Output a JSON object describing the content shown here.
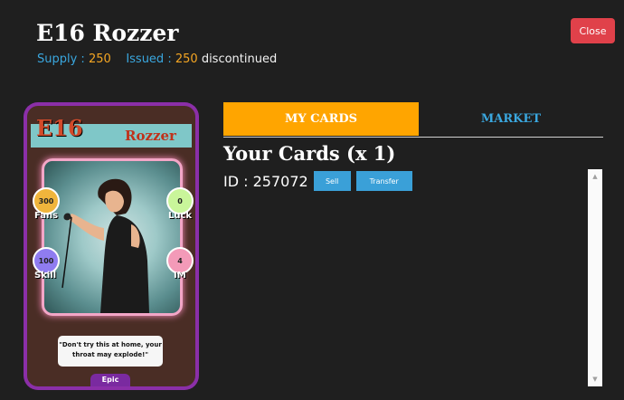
{
  "header": {
    "title": "E16 Rozzer",
    "supply_label": "Supply :",
    "supply_value": "250",
    "issued_label": "Issued :",
    "issued_value": "250",
    "status": "discontinued",
    "close_label": "Close"
  },
  "card": {
    "number": "E16",
    "name": "Rozzer",
    "stats": {
      "fans": {
        "value": "300",
        "label": "Fans"
      },
      "luck": {
        "value": "0",
        "label": "Luck"
      },
      "skill": {
        "value": "100",
        "label": "Skill"
      },
      "im": {
        "value": "4",
        "label": "IM"
      }
    },
    "quote": "\"Don't try this at home, your throat may explode!\"",
    "rarity": "Epic"
  },
  "tabs": [
    {
      "label": "MY CARDS",
      "active": true
    },
    {
      "label": "MARKET",
      "active": false
    }
  ],
  "your_cards": {
    "heading": "Your Cards (x 1)",
    "id_text": "ID : 257072",
    "sell_label": "Sell",
    "transfer_label": "Transfer"
  },
  "colors": {
    "accent_orange": "#ffa500",
    "link_blue": "#3aa7df",
    "close_red": "#e0414a",
    "value_orange": "#f5a623"
  }
}
